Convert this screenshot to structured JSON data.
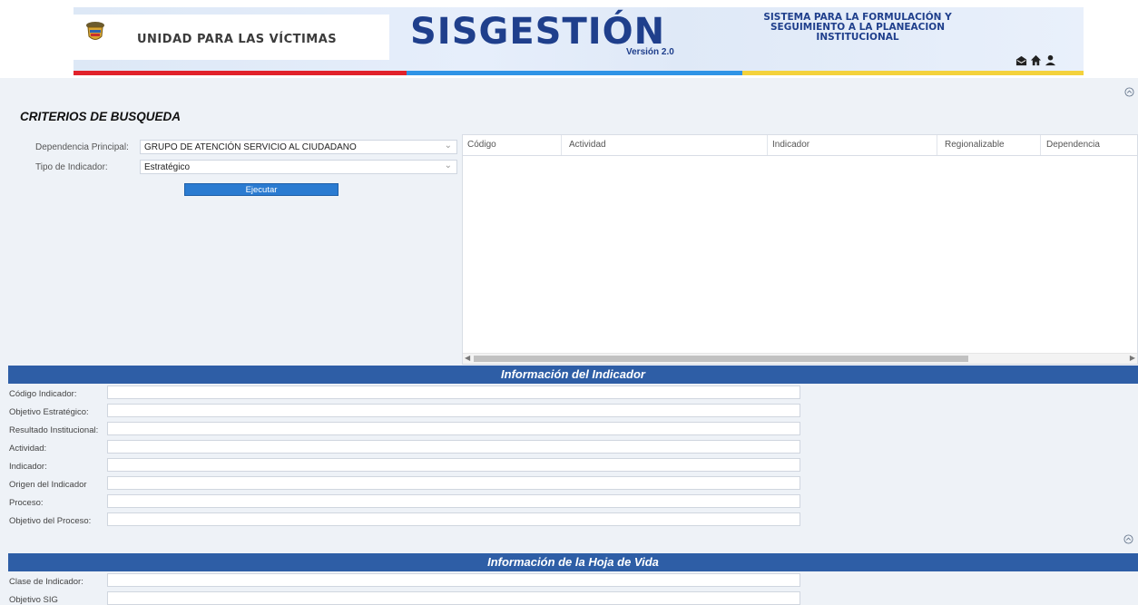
{
  "header": {
    "org_name": "UNIDAD PARA LAS VÍCTIMAS",
    "app_title": "SISGESTIÓN",
    "app_version": "Versión 2.0",
    "app_subtitle": "SISTEMA PARA LA FORMULACIÓN Y SEGUIMIENTO A LA PLANEACION INSTITUCIONAL",
    "icons": [
      "mail-icon",
      "home-icon",
      "user-icon"
    ],
    "stripe_colors": [
      "#e1222b",
      "#2f94e6",
      "#f4d23c"
    ]
  },
  "criteria": {
    "title": "CRITERIOS DE BUSQUEDA",
    "dependencia_label": "Dependencia Principal:",
    "dependencia_value": "GRUPO DE ATENCIÓN SERVICIO AL CIUDADANO",
    "tipo_label": "Tipo de Indicador:",
    "tipo_value": "Estratégico",
    "execute_label": "Ejecutar"
  },
  "grid": {
    "columns": [
      "Código",
      "Actividad",
      "Indicador",
      "Regionalizable",
      "Dependencia"
    ],
    "rows": []
  },
  "indicator_info": {
    "title": "Información del Indicador",
    "fields": [
      {
        "label": "Código Indicador:",
        "value": ""
      },
      {
        "label": "Objetivo Estratégico:",
        "value": ""
      },
      {
        "label": "Resultado Institucional:",
        "value": ""
      },
      {
        "label": "Actividad:",
        "value": ""
      },
      {
        "label": "Indicador:",
        "value": ""
      },
      {
        "label": "Origen del Indicador",
        "value": ""
      },
      {
        "label": "Proceso:",
        "value": ""
      },
      {
        "label": "Objetivo del Proceso:",
        "value": ""
      }
    ]
  },
  "cv_info": {
    "title": "Información de la Hoja de Vida",
    "fields": [
      {
        "label": "Clase de Indicador:",
        "value": ""
      },
      {
        "label": "Objetivo SIG",
        "value": ""
      }
    ]
  },
  "colors": {
    "section_bar": "#2e5ea6",
    "button": "#2a7bd1",
    "brand": "#1f3f8c"
  }
}
